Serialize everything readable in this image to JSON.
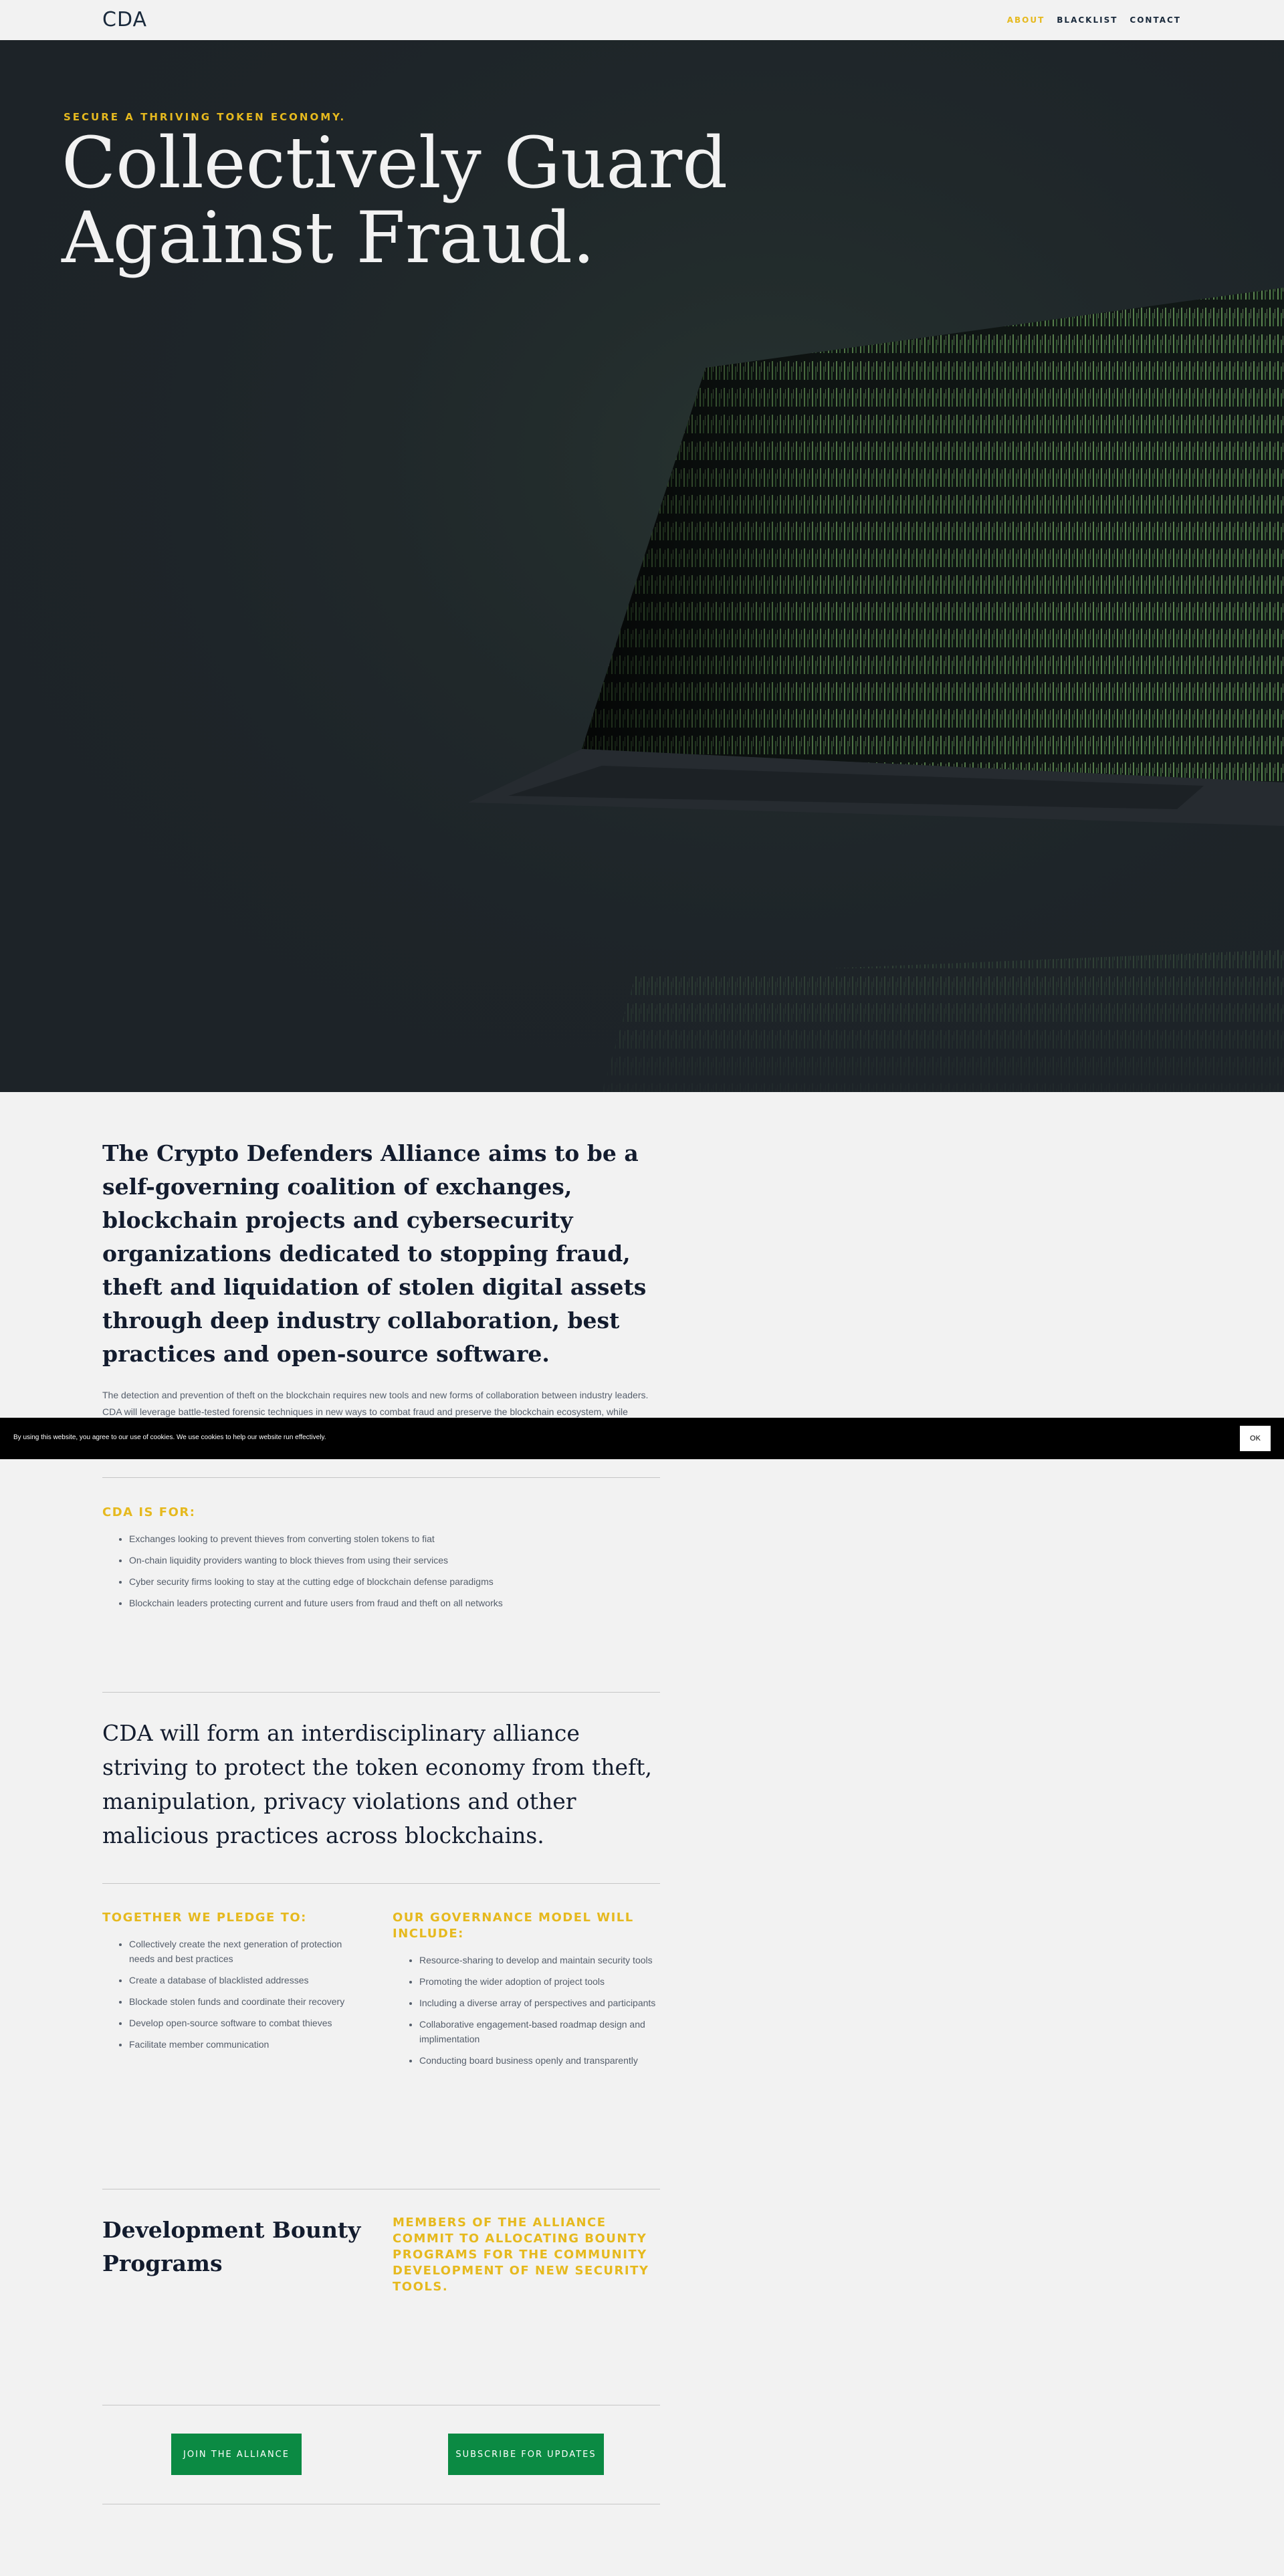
{
  "header": {
    "logo": "CDA",
    "nav": [
      {
        "label": "ABOUT",
        "active": true
      },
      {
        "label": "BLACKLIST",
        "active": false
      },
      {
        "label": "CONTACT",
        "active": false
      }
    ]
  },
  "hero": {
    "kicker": "SECURE A THRIVING TOKEN ECONOMY.",
    "title_line1": "Collectively Guard",
    "title_line2": "Against Fraud."
  },
  "intro": {
    "lead": "The Crypto Defenders Alliance aims to be a self-governing coalition of exchanges, blockchain projects and cybersecurity organizations dedicated to stopping fraud, theft and liquidation of stolen digital assets through deep industry collaboration, best practices and open-source software.",
    "body": "The detection and prevention of theft on the blockchain requires new tools and new forms of collaboration between industry leaders. CDA will leverage battle-tested forensic techniques in new ways to combat fraud and preserve the blockchain ecosystem, while orchestrating best practices for coordinated emergency evaluation and response across sectors."
  },
  "cda_for": {
    "heading": "CDA IS FOR:",
    "items": [
      "Exchanges looking to prevent thieves from converting stolen tokens to fiat",
      "On-chain liquidity providers wanting to block thieves from using their services",
      "Cyber security firms looking to stay at the cutting edge of blockchain defense paradigms",
      "Blockchain leaders protecting current and future users from fraud and theft on all networks"
    ]
  },
  "statement": "CDA will form an interdisciplinary alliance striving to protect the token economy from theft, manipulation, privacy violations and other malicious practices across blockchains.",
  "pledge": {
    "heading": "TOGETHER WE PLEDGE TO:",
    "items": [
      "Collectively create the next generation of protection needs and best practices",
      "Create a database of blacklisted addresses",
      "Blockade stolen funds and coordinate their recovery",
      "Develop open-source software to combat thieves",
      "Facilitate member communication"
    ]
  },
  "governance": {
    "heading": "OUR GOVERNANCE MODEL WILL INCLUDE:",
    "items": [
      "Resource-sharing to develop and maintain security tools",
      "Promoting the wider adoption of project tools",
      "Including a diverse array of perspectives and participants",
      "Collaborative engagement-based roadmap design and implimentation",
      "Conducting board business openly and transparently"
    ]
  },
  "bounty": {
    "title": "Development Bounty Programs",
    "text": "MEMBERS OF THE ALLIANCE COMMIT TO ALLOCATING BOUNTY PROGRAMS FOR THE COMMUNITY DEVELOPMENT OF NEW SECURITY TOOLS."
  },
  "cta": {
    "join": "JOIN THE ALLIANCE",
    "subscribe": "SUBSCRIBE FOR UPDATES"
  },
  "cookie": {
    "text": "By using this website, you agree to our use of cookies. We use cookies to help our website run effectively.",
    "ok": "OK"
  },
  "colors": {
    "accent": "#e6b91e",
    "button": "#0b8a43",
    "hero_bg": "#1d2328"
  }
}
